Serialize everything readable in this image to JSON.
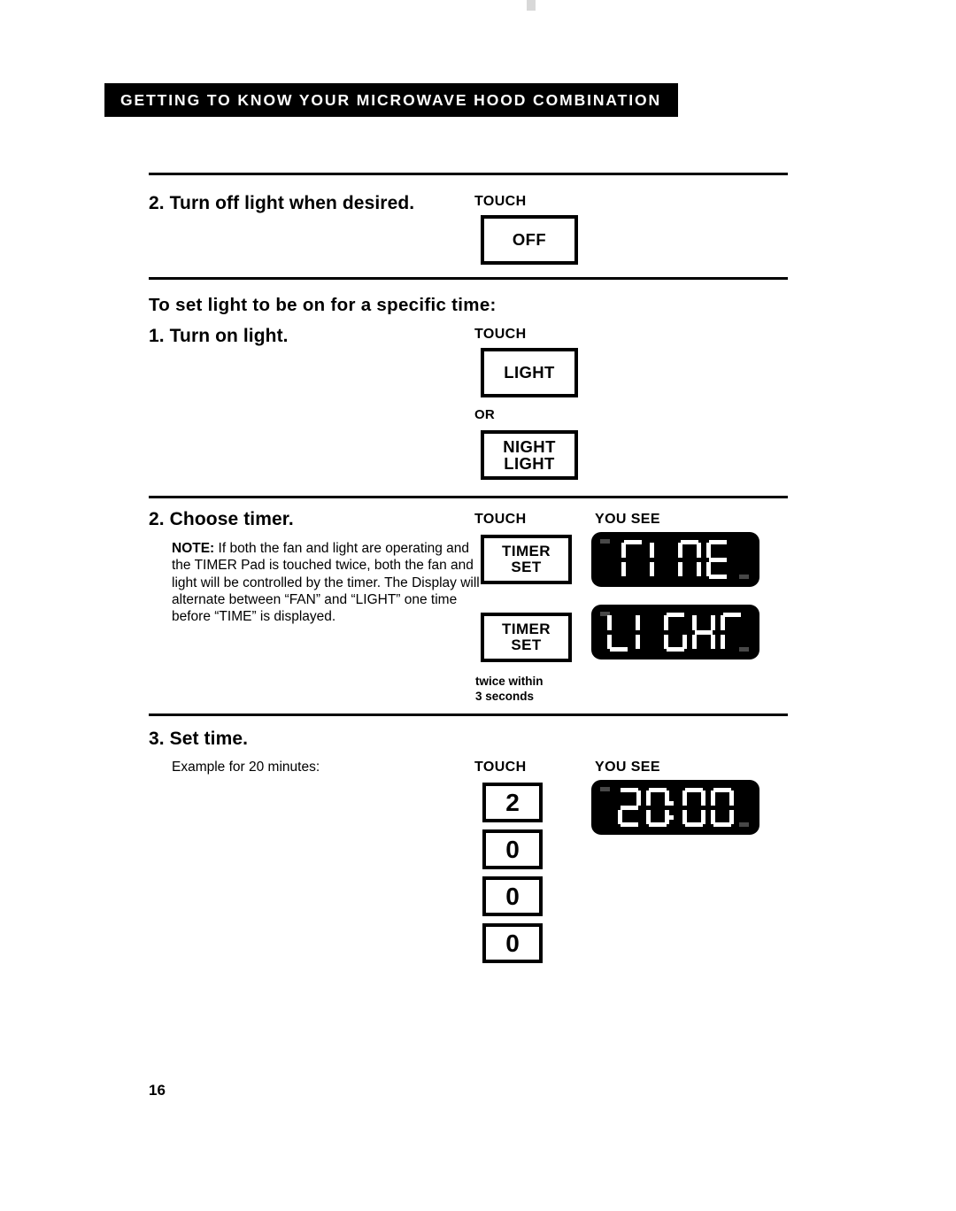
{
  "document": {
    "header_banner": "GETTING TO KNOW YOUR MICROWAVE HOOD COMBINATION",
    "page_number": "16"
  },
  "sections": [
    {
      "id": "turn-off-light",
      "heading": "2. Turn off light when desired.",
      "touch_label": "TOUCH",
      "pads": [
        {
          "label": "OFF"
        }
      ]
    },
    {
      "id": "set-light-specific-time",
      "section_heading": "To set light to be on for a specific time:",
      "heading": "1. Turn on light.",
      "touch_label": "TOUCH",
      "or_label": "OR",
      "pads": [
        {
          "label": "LIGHT"
        },
        {
          "label_line1": "NIGHT",
          "label_line2": "LIGHT"
        }
      ]
    },
    {
      "id": "choose-timer",
      "heading": "2. Choose timer.",
      "note_prefix": "NOTE:",
      "note_text": " If both the fan and light are operating and the TIMER Pad is touched twice, both the fan and light will be controlled by the timer. The Display will alternate between “FAN” and “LIGHT” one time before “TIME” is displayed.",
      "touch_label": "TOUCH",
      "you_see_label": "YOU SEE",
      "pads": [
        {
          "label_line1": "TIMER",
          "label_line2": "SET"
        },
        {
          "label_line1": "TIMER",
          "label_line2": "SET"
        }
      ],
      "footnote_line1": "twice within",
      "footnote_line2": "3 seconds",
      "displays": [
        {
          "text": "TIME"
        },
        {
          "text": "LIGHT"
        }
      ]
    },
    {
      "id": "set-time",
      "heading": "3. Set time.",
      "example_text": "Example for 20 minutes:",
      "touch_label": "TOUCH",
      "you_see_label": "YOU SEE",
      "pads": [
        {
          "label": "2"
        },
        {
          "label": "0"
        },
        {
          "label": "0"
        },
        {
          "label": "0"
        }
      ],
      "displays": [
        {
          "text": "20:00"
        }
      ]
    }
  ],
  "colors": {
    "ink": "#000000",
    "paper": "#ffffff",
    "display_background": "#000000",
    "display_segment": "#ffffff"
  }
}
